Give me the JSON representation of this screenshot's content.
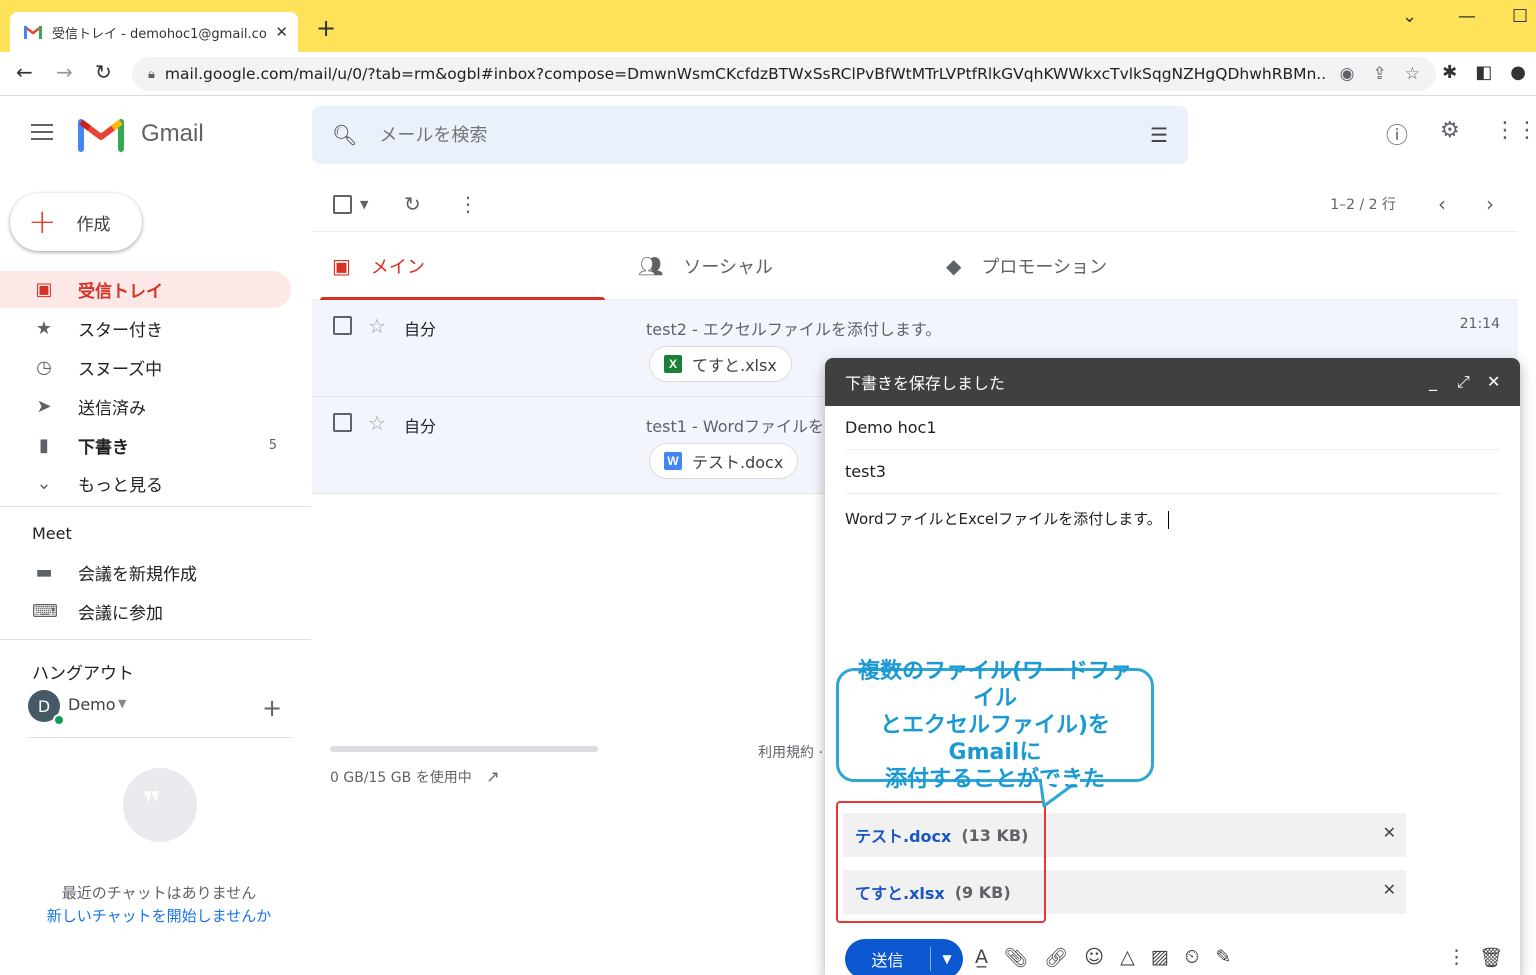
{
  "browser": {
    "tab_title": "受信トレイ - demohoc1@gmail.co",
    "url": "mail.google.com/mail/u/0/?tab=rm&ogbl#inbox?compose=DmwnWsmCKcfdzBTWxSsRClPvBfWtMTrLVPtfRlkGVqhKWWkxcTvlkSqgNZHgQDhwhRBMn..."
  },
  "gmail": {
    "logo_text": "Gmail",
    "search_placeholder": "メールを検索"
  },
  "sidebar": {
    "compose_label": "作成",
    "items": [
      {
        "label": "受信トレイ",
        "icon": "inbox-icon"
      },
      {
        "label": "スター付き",
        "icon": "star-icon"
      },
      {
        "label": "スヌーズ中",
        "icon": "clock-icon"
      },
      {
        "label": "送信済み",
        "icon": "send-icon"
      },
      {
        "label": "下書き",
        "icon": "draft-icon",
        "count": "5"
      },
      {
        "label": "もっと見る",
        "icon": "chevron-down-icon"
      }
    ],
    "meet_header": "Meet",
    "meet_items": [
      {
        "label": "会議を新規作成",
        "icon": "video-icon"
      },
      {
        "label": "会議に参加",
        "icon": "keyboard-icon"
      }
    ],
    "hangouts_header": "ハングアウト",
    "hangouts_user": "Demo",
    "avatar_letter": "D",
    "no_chats": "最近のチャットはありません",
    "start_chat": "新しいチャットを開始しませんか"
  },
  "list": {
    "pager": "1–2 / 2 行",
    "tabs": [
      {
        "label": "メイン",
        "icon": "inbox-icon"
      },
      {
        "label": "ソーシャル",
        "icon": "people-icon"
      },
      {
        "label": "プロモーション",
        "icon": "tag-icon"
      }
    ],
    "rows": [
      {
        "sender": "自分",
        "subject": "test2 - エクセルファイルを添付します。",
        "time": "21:14",
        "attachment": "てすと.xlsx",
        "att_type": "X"
      },
      {
        "sender": "自分",
        "subject": "test1 - Wordファイルを",
        "time": "",
        "attachment": "テスト.docx",
        "att_type": "W"
      }
    ],
    "storage": "0 GB/15 GB を使用中",
    "terms": "利用規約 ·"
  },
  "compose": {
    "header": "下書きを保存しました",
    "to": "Demo hoc1",
    "subject": "test3",
    "body": "WordファイルとExcelファイルを添付します。",
    "attachments": [
      {
        "name": "テスト.docx",
        "size": "(13 KB)"
      },
      {
        "name": "てすと.xlsx",
        "size": "(9 KB)"
      }
    ],
    "send_label": "送信"
  },
  "callout": {
    "line1": "複数のファイル(ワードファイル",
    "line2": "とエクセルファイル)をGmailに",
    "line3": "添付することができた"
  },
  "colors": {
    "chrome_bar": "#fde25a",
    "accent_red": "#d93025",
    "send_blue": "#0b57d0",
    "callout_blue": "#30a6d4"
  }
}
